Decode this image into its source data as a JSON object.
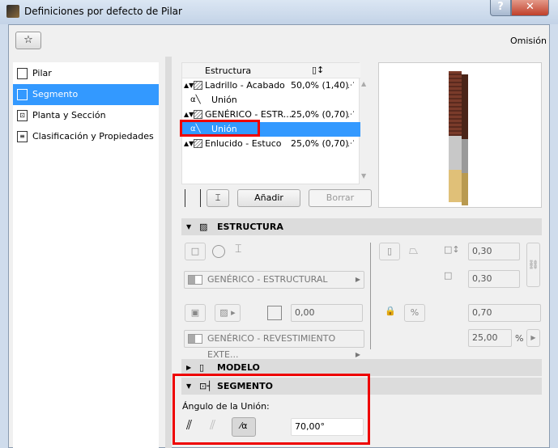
{
  "window": {
    "title": "Definiciones por defecto de Pilar",
    "help": "?",
    "close": "✕"
  },
  "header": {
    "favorites_icon": "favorites-icon",
    "omision": "Omisión"
  },
  "sidebar": {
    "items": [
      {
        "label": "Pilar",
        "icon": "column-icon"
      },
      {
        "label": "Segmento",
        "icon": "segment-icon",
        "selected": true
      },
      {
        "label": "Planta y Sección",
        "icon": "floor-plan-icon"
      },
      {
        "label": "Clasificación y Propiedades",
        "icon": "properties-icon"
      }
    ]
  },
  "structure_list": {
    "header_name": "Estructura",
    "header_height": "▯↕",
    "rows": [
      {
        "type": "segment",
        "name": "Ladrillo - Acabado",
        "value": "50,0% (1,40)"
      },
      {
        "type": "joint",
        "name": "Unión"
      },
      {
        "type": "segment",
        "name": "GENÉRICO - ESTR...",
        "value": "25,0% (0,70)"
      },
      {
        "type": "joint",
        "name": "Unión",
        "selected": true
      },
      {
        "type": "segment",
        "name": "Enlucido - Estuco",
        "value": "25,0% (0,70)"
      }
    ],
    "add": "Añadir",
    "delete": "Borrar"
  },
  "estructura": {
    "title": "ESTRUCTURA",
    "building_material": "GENÉRICO - ESTRUCTURAL",
    "veneer_thickness": "0,00",
    "veneer_material": "GENÉRICO - REVESTIMIENTO EXTE...",
    "width": "0,30",
    "depth": "0,30",
    "height": "0,70",
    "percent": "25,00",
    "percent_unit": "%"
  },
  "modelo": {
    "title": "MODELO"
  },
  "segmento": {
    "title": "SEGMENTO",
    "angle_label": "Ángulo de la Unión:",
    "angle_value": "70,00°"
  },
  "colors": {
    "selection": "#3399ff",
    "highlight": "#e00000"
  }
}
